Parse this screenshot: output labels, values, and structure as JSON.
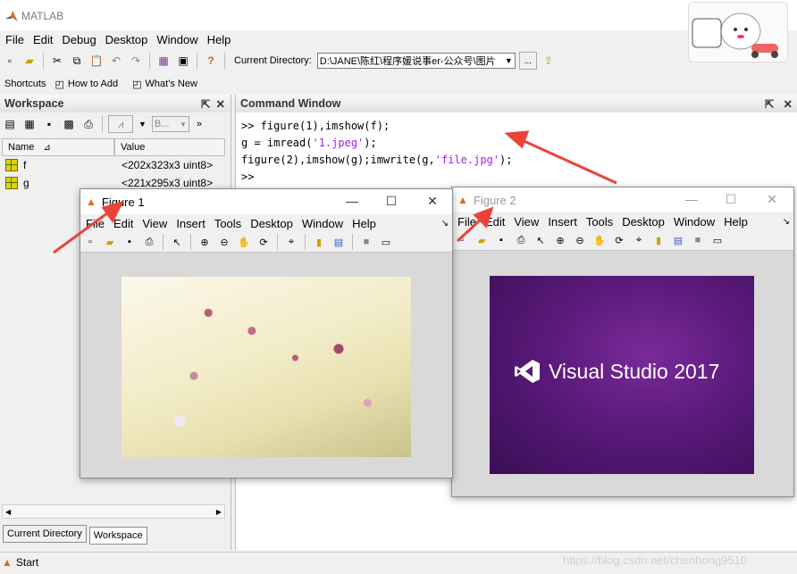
{
  "app": {
    "title": "MATLAB"
  },
  "menubar": [
    "File",
    "Edit",
    "Debug",
    "Desktop",
    "Window",
    "Help"
  ],
  "toolbar": {
    "current_directory_label": "Current Directory:",
    "current_directory_value": "D:\\JANE\\陈红\\程序媛说事er-公众号\\图片",
    "ellipsis": "..."
  },
  "shortcuts": {
    "label": "Shortcuts",
    "items": [
      "How to Add",
      "What's New"
    ]
  },
  "workspace": {
    "title": "Workspace",
    "stack_value": "B...",
    "columns": [
      "Name",
      "Value"
    ],
    "variables": [
      {
        "name": "f",
        "value": "<202x323x3 uint8>"
      },
      {
        "name": "g",
        "value": "<221x295x3 uint8>"
      }
    ],
    "tabs": [
      "Current Directory",
      "Workspace"
    ]
  },
  "command_window": {
    "title": "Command Window",
    "lines": [
      {
        "pre": ">> figure(1),imshow(f);",
        "str": "",
        "post": ""
      },
      {
        "pre": "g = imread(",
        "str": "'1.jpeg'",
        "post": ");"
      },
      {
        "pre": "figure(2),imshow(g);imwrite(g,",
        "str": "'file.jpg'",
        "post": ");"
      },
      {
        "pre": ">>",
        "str": "",
        "post": ""
      }
    ]
  },
  "figure1": {
    "title": "Figure 1",
    "menu": [
      "File",
      "Edit",
      "View",
      "Insert",
      "Tools",
      "Desktop",
      "Window",
      "Help"
    ]
  },
  "figure2": {
    "title": "Figure 2",
    "menu": [
      "File",
      "Edit",
      "View",
      "Insert",
      "Tools",
      "Desktop",
      "Window",
      "Help"
    ],
    "image_text": "Visual Studio 2017"
  },
  "status": {
    "start": "Start"
  },
  "watermark": "https://blog.csdn.net/chenhong9510",
  "colors": {
    "arrow": "#e8443a",
    "string_literal": "#a020f0",
    "vs_purple": "#5a1a7a"
  }
}
